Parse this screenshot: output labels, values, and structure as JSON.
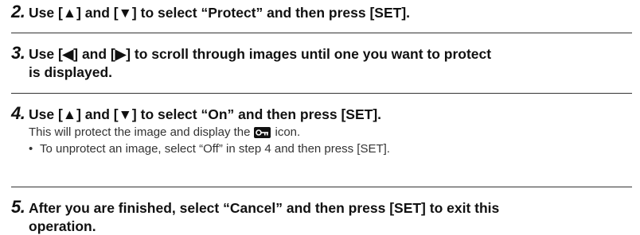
{
  "steps": [
    {
      "number": "2.",
      "text": "Use [▲] and [▼] to select “Protect” and then press [SET]."
    },
    {
      "number": "3.",
      "text": "Use [◀] and [▶] to scroll through images until one you want to protect",
      "continuation": "is displayed."
    },
    {
      "number": "4.",
      "text": "Use [▲] and [▼] to select “On” and then press [SET].",
      "body_before_icon": "This will protect the image and display the",
      "body_after_icon": "icon.",
      "icon": "protect-key-icon",
      "bullet": "•",
      "bullet_text": "To unprotect an image, select “Off” in step 4 and then press [SET]."
    },
    {
      "number": "5.",
      "text": "After you are finished, select “Cancel” and then press [SET] to exit this",
      "continuation": "operation."
    }
  ]
}
